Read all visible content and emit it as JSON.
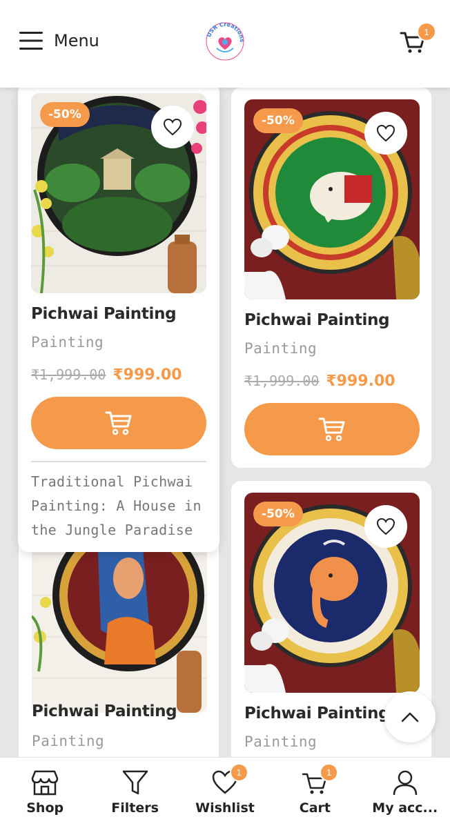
{
  "header": {
    "menu_label": "Menu",
    "logo_text": "USR Creations",
    "cart_count": "1"
  },
  "products": [
    {
      "discount": "-50%",
      "title": "Pichwai Painting",
      "category": "Painting",
      "old_price": "₹1,999.00",
      "new_price": "₹999.00",
      "description": "Traditional Pichwai Painting: A House in the Jungle Paradise"
    },
    {
      "discount": "-50%",
      "title": "Pichwai Painting",
      "category": "Painting",
      "old_price": "₹1,999.00",
      "new_price": "₹999.00"
    },
    {
      "title": "Pichwai Painting",
      "category": "Painting"
    },
    {
      "discount": "-50%",
      "title": "Pichwai Painting",
      "category": "Painting"
    }
  ],
  "bottom_nav": [
    {
      "label": "Shop"
    },
    {
      "label": "Filters"
    },
    {
      "label": "Wishlist",
      "badge": "1"
    },
    {
      "label": "Cart",
      "badge": "1"
    },
    {
      "label": "My acc..."
    }
  ],
  "colors": {
    "accent": "#f59a4b",
    "background": "#e6e6e6",
    "maroon": "#7a1f1f"
  }
}
